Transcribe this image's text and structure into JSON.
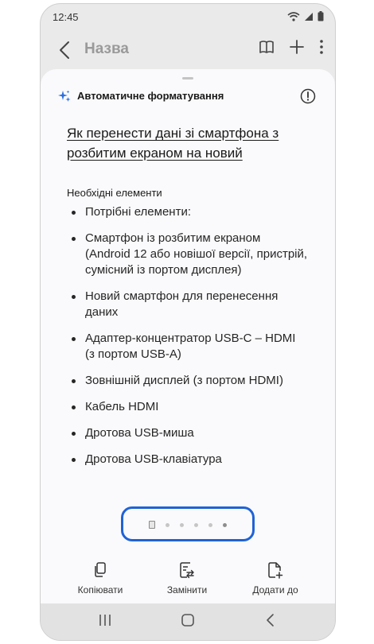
{
  "status": {
    "time": "12:45"
  },
  "appbar": {
    "title": "Назва"
  },
  "sheet": {
    "header_label": "Автоматичне форматування",
    "doc_title": "Як перенести дані зі смартфона з розбитим екраном на новий",
    "section_label": "Необхідні елементи",
    "items": [
      "Потрібні елементи:",
      "Смартфон із розбитим екраном (Android 12 або новішої версії, пристрій, сумісний із портом дисплея)",
      "Новий смартфон для перенесення даних",
      "Адаптер-концентратор USB-C – HDMI (з портом USB-A)",
      "Зовнішній дисплей (з портом HDMI)",
      "Кабель HDMI",
      "Дротова USB-миша",
      "Дротова USB-клавіатура"
    ],
    "pager": {
      "total_pages": 6,
      "current_page": 6
    }
  },
  "actions": {
    "copy": "Копіювати",
    "replace": "Замінити",
    "add_to": "Додати до"
  },
  "colors": {
    "accent": "#1f63d6"
  }
}
